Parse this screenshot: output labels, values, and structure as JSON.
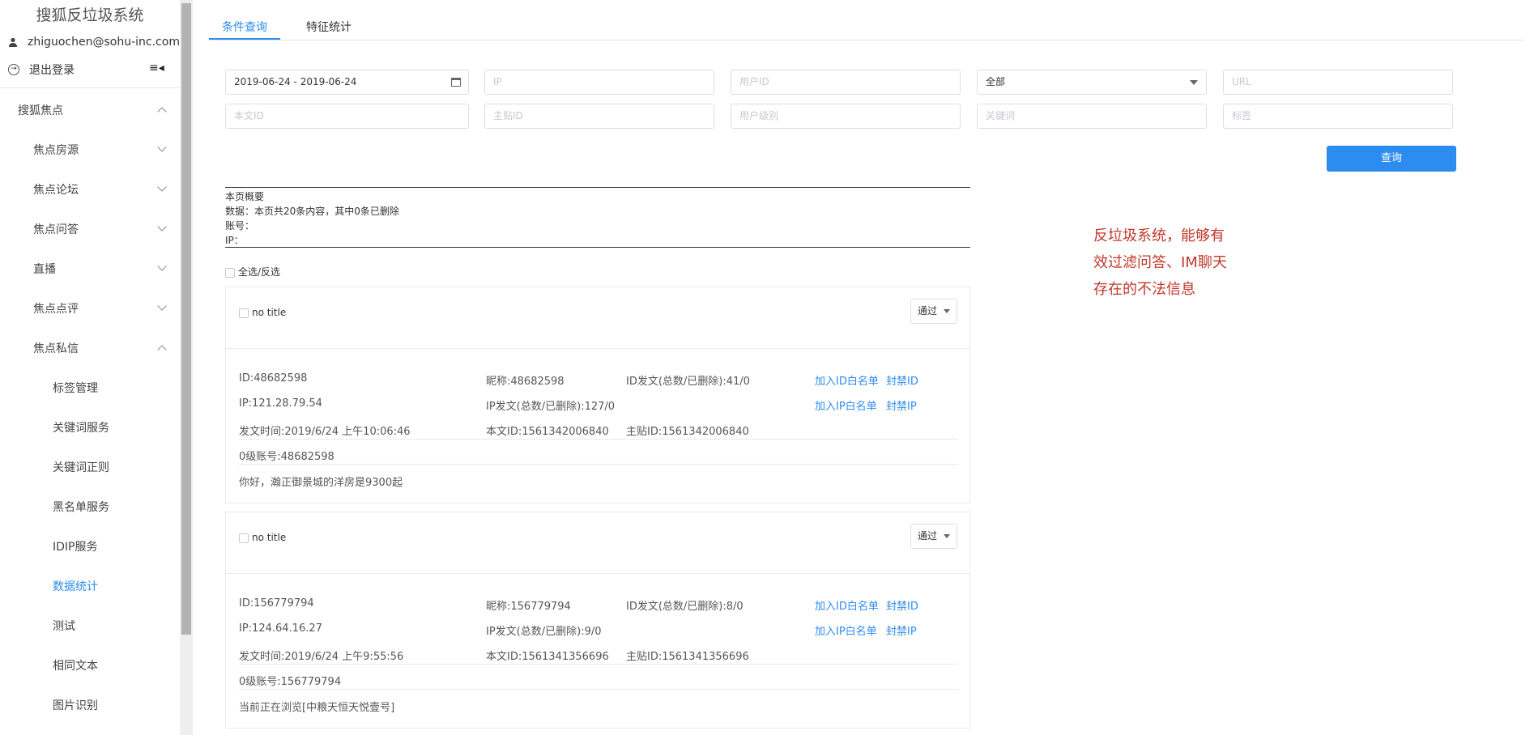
{
  "sidebar": {
    "title": "搜狐反垃圾系统",
    "user_email": "zhiguochen@sohu-inc.com",
    "logout_label": "退出登录",
    "toggle_icon": "≡◂",
    "groups": [
      {
        "label": "搜狐焦点",
        "state": "expanded"
      },
      {
        "label": "焦点房源",
        "state": "collapsed"
      },
      {
        "label": "焦点论坛",
        "state": "collapsed"
      },
      {
        "label": "焦点问答",
        "state": "collapsed"
      },
      {
        "label": "直播",
        "state": "collapsed"
      },
      {
        "label": "焦点点评",
        "state": "collapsed"
      },
      {
        "label": "焦点私信",
        "state": "expanded"
      }
    ],
    "subitems": [
      {
        "label": "标签管理",
        "active": false
      },
      {
        "label": "关键词服务",
        "active": false
      },
      {
        "label": "关键词正则",
        "active": false
      },
      {
        "label": "黑名单服务",
        "active": false
      },
      {
        "label": "IDIP服务",
        "active": false
      },
      {
        "label": "数据统计",
        "active": true
      },
      {
        "label": "测试",
        "active": false
      },
      {
        "label": "相同文本",
        "active": false
      },
      {
        "label": "图片识别",
        "active": false
      }
    ]
  },
  "tabs": [
    {
      "label": "条件查询",
      "active": true
    },
    {
      "label": "特征统计",
      "active": false
    }
  ],
  "filters": {
    "date_range": "2019-06-24 - 2019-06-24",
    "ip_placeholder": "IP",
    "user_id_placeholder": "用户ID",
    "status_select": "全部",
    "url_placeholder": "URL",
    "text_id_placeholder": "本文ID",
    "post_id_placeholder": "主贴ID",
    "user_level_placeholder": "用户级别",
    "keyword_placeholder": "关键词",
    "tag_placeholder": "标签"
  },
  "query_button": "查询",
  "summary": {
    "heading": "本页概要",
    "data_line": "数据：本页共20条内容，其中0条已删除",
    "account_line": "账号：",
    "ip_line": "IP："
  },
  "select_all_label": "全选/反选",
  "records": [
    {
      "title": "no title",
      "status": "通过",
      "id": "ID:48682598",
      "nickname": "昵称:48682598",
      "id_posts": "ID发文(总数/已删除):41/0",
      "ip": "IP:121.28.79.54",
      "ip_posts": "IP发文(总数/已删除):127/0",
      "post_time": "发文时间:2019/6/24 上午10:06:46",
      "text_id": "本文ID:1561342006840",
      "main_post_id": "主贴ID:1561342006840",
      "account_level": "0级账号:48682598",
      "content": "你好，瀚正御景城的洋房是9300起",
      "link_id_whitelist": "加入ID白名单",
      "link_ban_id": "封禁ID",
      "link_ip_whitelist": "加入IP白名单",
      "link_ban_ip": "封禁IP"
    },
    {
      "title": "no title",
      "status": "通过",
      "id": "ID:156779794",
      "nickname": "昵称:156779794",
      "id_posts": "ID发文(总数/已删除):8/0",
      "ip": "IP:124.64.16.27",
      "ip_posts": "IP发文(总数/已删除):9/0",
      "post_time": "发文时间:2019/6/24 上午9:55:56",
      "text_id": "本文ID:1561341356696",
      "main_post_id": "主贴ID:1561341356696",
      "account_level": "0级账号:156779794",
      "content": "当前正在浏览[中粮天恒天悦壹号]",
      "link_id_whitelist": "加入ID白名单",
      "link_ban_id": "封禁ID",
      "link_ip_whitelist": "加入IP白名单",
      "link_ban_ip": "封禁IP"
    }
  ],
  "annotation": {
    "line1": "反垃圾系统，能够有",
    "line2": "效过滤问答、IM聊天",
    "line3": "存在的不法信息",
    "color": "#c0392b"
  },
  "colors": {
    "accent": "#2d8cf0"
  }
}
